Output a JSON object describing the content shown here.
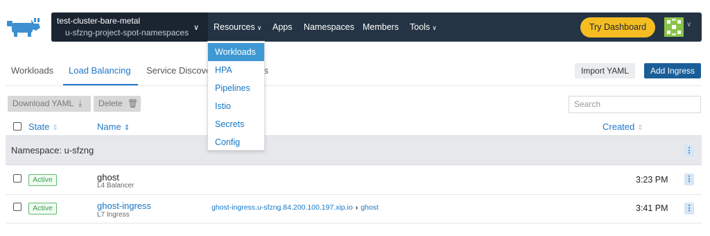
{
  "header": {
    "cluster_name": "test-cluster-bare-metal",
    "project_name": "u-sfzng-project-spot-namespaces",
    "nav": {
      "resources": "Resources",
      "apps": "Apps",
      "namespaces": "Namespaces",
      "members": "Members",
      "tools": "Tools"
    },
    "try_dashboard": "Try Dashboard",
    "icons": {
      "logo": "rancher-cow-logo",
      "avatar": "identicon-avatar"
    }
  },
  "resources_menu": {
    "items": [
      "Workloads",
      "HPA",
      "Pipelines",
      "Istio",
      "Secrets",
      "Config"
    ],
    "active": "Workloads"
  },
  "tabs": {
    "workloads": "Workloads",
    "load_balancing": "Load Balancing",
    "service_discovery": "Service Discove",
    "tail": "ss",
    "active": "Load Balancing"
  },
  "actions": {
    "import_yaml": "Import YAML",
    "add_ingress": "Add Ingress",
    "download_yaml": "Download YAML",
    "delete": "Delete"
  },
  "search": {
    "placeholder": "Search"
  },
  "table": {
    "columns": {
      "state": "State",
      "name": "Name",
      "created": "Created"
    },
    "group_label": "Namespace: u-sfzng",
    "rows": [
      {
        "state": "Active",
        "name": "ghost",
        "type": "L4 Balancer",
        "target_host": "",
        "target_service": "",
        "created": "3:23 PM"
      },
      {
        "state": "Active",
        "name": "ghost-ingress",
        "type": "L7 Ingress",
        "target_host": "ghost-ingress.u-sfzng.84.200.100.197.xip.io",
        "target_service": "ghost",
        "created": "3:41 PM"
      }
    ]
  },
  "colors": {
    "header_bg": "#243444",
    "accent_blue": "#2076c9",
    "try_button": "#f5bd22",
    "add_button": "#1a5e98",
    "active_green": "#3a9a4b"
  }
}
